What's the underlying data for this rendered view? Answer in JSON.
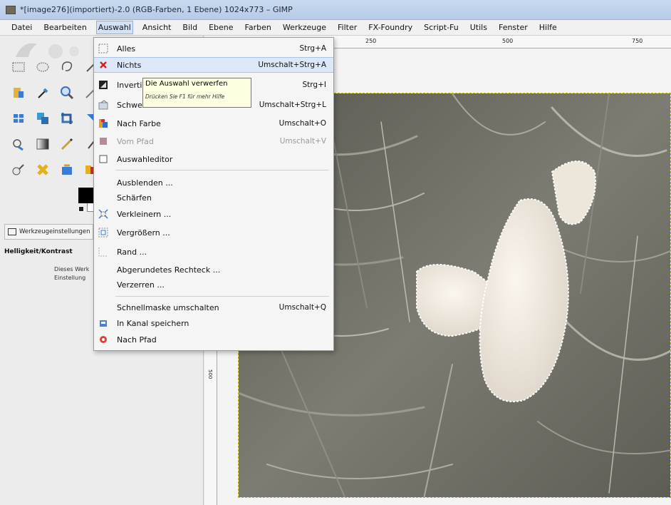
{
  "window": {
    "title": "*[image276](importiert)-2.0 (RGB-Farben, 1 Ebene) 1024x773 – GIMP"
  },
  "menubar": {
    "items": [
      "Datei",
      "Bearbeiten",
      "Auswahl",
      "Ansicht",
      "Bild",
      "Ebene",
      "Farben",
      "Werkzeuge",
      "Filter",
      "FX-Foundry",
      "Script-Fu",
      "Utils",
      "Fenster",
      "Hilfe"
    ],
    "active": "Auswahl"
  },
  "toolbox": {
    "tools": [
      "rect-select",
      "ellipse-select",
      "free-select",
      "fuzzy-select",
      "select-by-color",
      "color-picker",
      "zoom",
      "measure",
      "move",
      "align",
      "crop",
      "rotate",
      "clone",
      "blend",
      "pencil",
      "paintbrush",
      "dodge-burn",
      "heal",
      "text",
      "color-dialog"
    ],
    "tool_options_tab": "Werkzeugeinstellungen",
    "tool_options_title": "Helligkeit/Kontrast",
    "tool_options_desc_line1": "Dieses Werk",
    "tool_options_desc_line2": "Einstellung"
  },
  "rulers": {
    "top": [
      "250",
      "500",
      "750"
    ],
    "left": [
      "500"
    ]
  },
  "select_menu": {
    "items": [
      {
        "label": "Alles",
        "shortcut": "Strg+A",
        "icon": "select-all-icon",
        "enabled": true
      },
      {
        "label": "Nichts",
        "shortcut": "Umschalt+Strg+A",
        "icon": "select-none-icon",
        "enabled": true,
        "hover": true
      },
      {
        "label": "Invertieren",
        "shortcut": "Strg+I",
        "icon": "invert-icon",
        "enabled": true
      },
      {
        "label": "Schwebend",
        "shortcut": "Umschalt+Strg+L",
        "icon": "float-icon",
        "enabled": true
      },
      {
        "label": "Nach Farbe",
        "shortcut": "Umschalt+O",
        "icon": "by-color-icon",
        "enabled": true
      },
      {
        "label": "Vom Pfad",
        "shortcut": "Umschalt+V",
        "icon": "from-path-icon",
        "enabled": false
      },
      {
        "label": "Auswahleditor",
        "shortcut": "",
        "icon": "selection-editor-icon",
        "enabled": true
      },
      {
        "label": "Ausblenden ...",
        "shortcut": "",
        "icon": "",
        "enabled": true
      },
      {
        "label": "Schärfen",
        "shortcut": "",
        "icon": "",
        "enabled": true
      },
      {
        "label": "Verkleinern ...",
        "shortcut": "",
        "icon": "shrink-icon",
        "enabled": true
      },
      {
        "label": "Vergrößern ...",
        "shortcut": "",
        "icon": "grow-icon",
        "enabled": true
      },
      {
        "label": "Rand ...",
        "shortcut": "",
        "icon": "border-icon",
        "enabled": true
      },
      {
        "label": "Abgerundetes Rechteck ...",
        "shortcut": "",
        "icon": "",
        "enabled": true
      },
      {
        "label": "Verzerren ...",
        "shortcut": "",
        "icon": "",
        "enabled": true
      },
      {
        "label": "Schnellmaske umschalten",
        "shortcut": "Umschalt+Q",
        "icon": "",
        "enabled": true
      },
      {
        "label": "In Kanal speichern",
        "shortcut": "",
        "icon": "save-channel-icon",
        "enabled": true
      },
      {
        "label": "Nach Pfad",
        "shortcut": "",
        "icon": "to-path-icon",
        "enabled": true
      }
    ]
  },
  "tooltip": {
    "text": "Die Auswahl verwerfen",
    "hint": "Drücken Sie F1 für mehr Hilfe"
  },
  "colors": {
    "menu_hover": "#dce8f7",
    "tooltip_bg": "#ffffe1",
    "selection_marching_ants": "#c9b600"
  }
}
